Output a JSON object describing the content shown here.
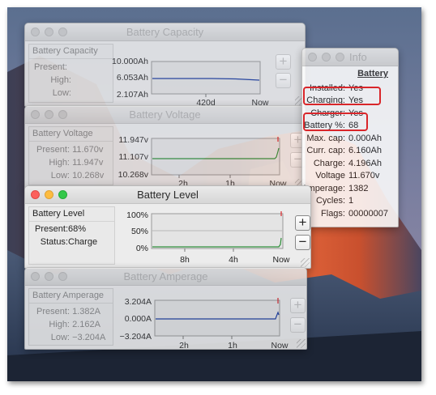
{
  "capacity": {
    "title": "Battery Capacity",
    "panel_title": "Battery Capacity",
    "rows": [
      {
        "key": "Present:",
        "value": ""
      },
      {
        "key": "High:",
        "value": ""
      },
      {
        "key": "Low:",
        "value": ""
      }
    ],
    "y_ticks": [
      "10.000Ah",
      "6.053Ah",
      "2.107Ah"
    ],
    "x_ticks": [
      "420d",
      "Now"
    ],
    "plus": "+",
    "minus": "−"
  },
  "voltage": {
    "title": "Battery Voltage",
    "panel_title": "Battery Voltage",
    "rows": [
      {
        "key": "Present:",
        "value": "11.670v"
      },
      {
        "key": "High:",
        "value": "11.947v"
      },
      {
        "key": "Low:",
        "value": "10.268v"
      }
    ],
    "y_ticks": [
      "11.947v",
      "11.107v",
      "10.268v"
    ],
    "x_ticks": [
      "2h",
      "1h",
      "Now"
    ],
    "plus": "+",
    "minus": "−"
  },
  "level": {
    "title": "Battery Level",
    "panel_title": "Battery Level",
    "rows": [
      {
        "key": "Present:",
        "value": "68%"
      },
      {
        "key": "Status:",
        "value": "Charge"
      }
    ],
    "y_ticks": [
      "100%",
      "50%",
      "0%"
    ],
    "x_ticks": [
      "8h",
      "4h",
      "Now"
    ],
    "plus": "+",
    "minus": "−"
  },
  "amperage": {
    "title": "Battery Amperage",
    "panel_title": "Battery Amperage",
    "rows": [
      {
        "key": "Present:",
        "value": "1.382A"
      },
      {
        "key": "High:",
        "value": "2.162A"
      },
      {
        "key": "Low:",
        "value": "−3.204A"
      }
    ],
    "y_ticks": [
      "3.204A",
      "0.000A",
      "−3.204A"
    ],
    "x_ticks": [
      "2h",
      "1h",
      "Now"
    ],
    "plus": "+",
    "minus": "−"
  },
  "info": {
    "title": "Info",
    "heading": "Battery",
    "rows": [
      {
        "key": "Installed:",
        "value": "Yes"
      },
      {
        "key": "Charging:",
        "value": "Yes"
      },
      {
        "key": "Charger:",
        "value": "Yes"
      },
      {
        "key": "Battery %:",
        "value": "68"
      },
      {
        "key": "Max. cap:",
        "value": "0.000Ah"
      },
      {
        "key": "Curr. cap:",
        "value": "6.160Ah"
      },
      {
        "key": "Charge:",
        "value": "4.196Ah"
      },
      {
        "key": "Voltage",
        "value": "11.670v"
      },
      {
        "key": "Amperage:",
        "value": "1382"
      },
      {
        "key": "Cycles:",
        "value": "1"
      },
      {
        "key": "Flags:",
        "value": "00000007"
      }
    ]
  },
  "colors": {
    "voltage_line": "#2f8f3a",
    "level_line": "#2f8f3a",
    "amperage_line": "#1f3fa0",
    "capacity_line": "#1f3fa0",
    "marker": "#d9262a",
    "highlight": "#d9262a"
  }
}
